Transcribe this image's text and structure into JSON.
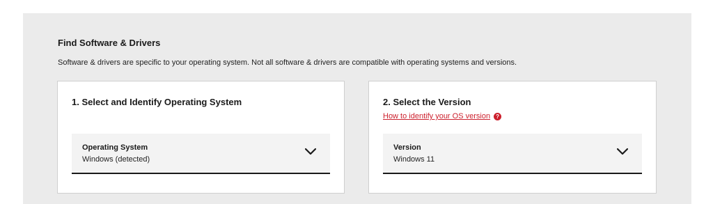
{
  "section": {
    "title": "Find Software & Drivers",
    "description": "Software & drivers are specific to your operating system. Not all software & drivers are compatible with operating systems and versions."
  },
  "os_card": {
    "title": "1. Select and Identify Operating System",
    "select_label": "Operating System",
    "select_value": "Windows (detected)",
    "icon": "chevron-down-icon"
  },
  "version_card": {
    "title": "2. Select the Version",
    "help_link": "How to identify your OS version",
    "help_icon_glyph": "?",
    "select_label": "Version",
    "select_value": "Windows 11",
    "icon": "chevron-down-icon"
  },
  "colors": {
    "accent": "#cc1f2c",
    "panel_bg": "#ebebeb",
    "select_bg": "#f3f3f3"
  }
}
